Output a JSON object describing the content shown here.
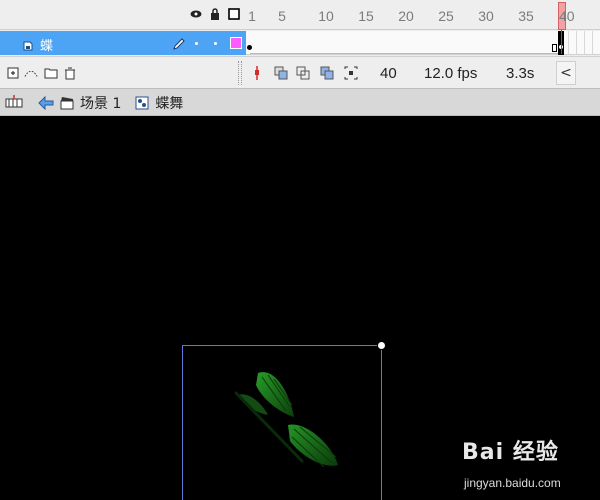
{
  "timeline": {
    "ruler_labels": [
      "1",
      "5",
      "10",
      "15",
      "20",
      "25",
      "30",
      "35",
      "40"
    ],
    "current_frame_label": "40",
    "layer": {
      "name": "蝶"
    },
    "footer": {
      "frame": "40",
      "fps": "12.0 fps",
      "time": "3.3s",
      "scroll_left": "<"
    }
  },
  "editbar": {
    "scene_label": "场景 1",
    "symbol_label": "蝶舞"
  },
  "watermark": {
    "logo_text": "Bai 经验",
    "url": "jingyan.baidu.com"
  },
  "colors": {
    "layer_highlight": "#4da3f4",
    "outline_color": "#ff5cff",
    "playhead": "#d42d2d",
    "selection_box": "#5d7ad8",
    "butterfly_green": "#1f8f1f"
  },
  "icons": {
    "eye": "eye-icon",
    "lock": "lock-icon",
    "outline": "outline-square-icon",
    "layer": "layer-icon",
    "pencil": "pencil-icon",
    "scene": "clapper-icon",
    "symbol": "movie-clip-icon"
  }
}
